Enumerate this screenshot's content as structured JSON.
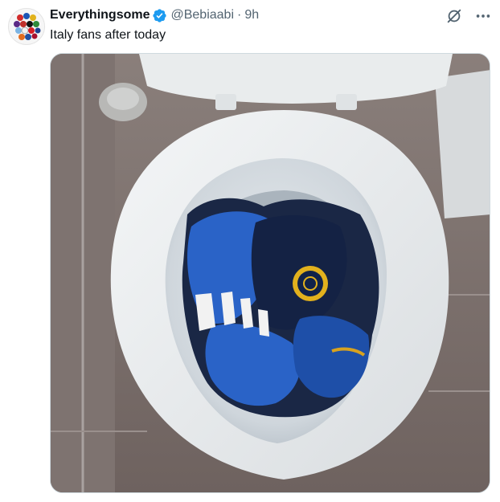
{
  "tweet": {
    "author": {
      "display_name": "Everythingsome",
      "handle": "@Bebiaabi",
      "verified": true,
      "avatar_icon": "club-badges-grid-icon"
    },
    "separator": "·",
    "time": "9h",
    "text": "Italy fans after today",
    "actions": {
      "grok_icon": "grok-icon",
      "more_icon": "more-dots-icon"
    },
    "media": {
      "type": "photo",
      "icon": "toilet-with-jerseys-photo"
    }
  },
  "colors": {
    "verified_blue": "#1d9bf0",
    "text_secondary": "#536471",
    "text_primary": "#0f1419",
    "jersey_blue": "#2a63c7",
    "jersey_black": "#111a2e"
  }
}
